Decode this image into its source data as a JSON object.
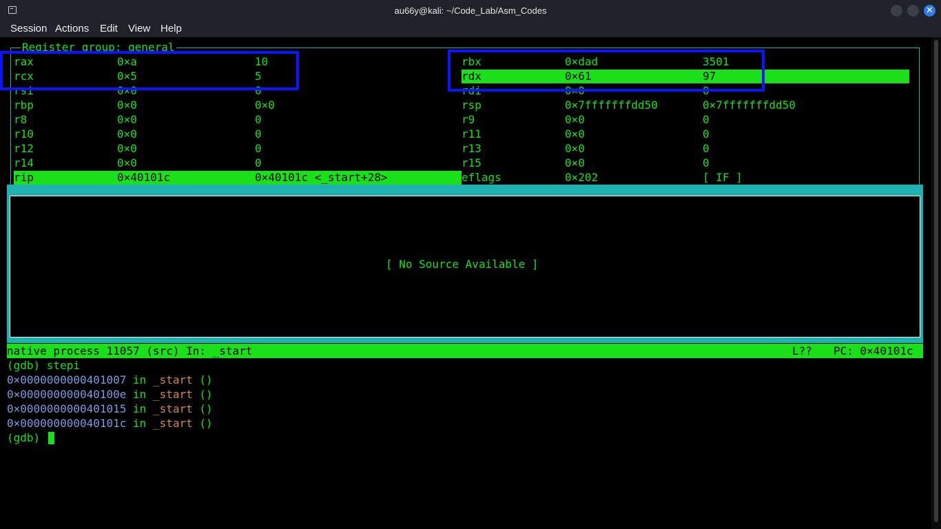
{
  "window": {
    "title": "au66y@kali: ~/Code_Lab/Asm_Codes",
    "close_glyph": "✕"
  },
  "menu": [
    "Session",
    "Actions",
    "Edit",
    "View",
    "Help"
  ],
  "registers": {
    "group_title": "Register group: general",
    "left": [
      {
        "name": "rax",
        "hex": "0×a",
        "val": "10"
      },
      {
        "name": "rcx",
        "hex": "0×5",
        "val": "5"
      },
      {
        "name": "rsi",
        "hex": "0×0",
        "val": "0"
      },
      {
        "name": "rbp",
        "hex": "0×0",
        "val": "0×0"
      },
      {
        "name": "r8",
        "hex": "0×0",
        "val": "0"
      },
      {
        "name": "r10",
        "hex": "0×0",
        "val": "0"
      },
      {
        "name": "r12",
        "hex": "0×0",
        "val": "0"
      },
      {
        "name": "r14",
        "hex": "0×0",
        "val": "0"
      },
      {
        "name": "rip",
        "hex": "0×40101c",
        "val": "0×40101c <_start+28>"
      }
    ],
    "right": [
      {
        "name": "rbx",
        "hex": "0×dad",
        "val": "3501"
      },
      {
        "name": "rdx",
        "hex": "0×61",
        "val": "97"
      },
      {
        "name": "rdi",
        "hex": "0×0",
        "val": "0"
      },
      {
        "name": "rsp",
        "hex": "0×7fffffffdd50",
        "val": "0×7fffffffdd50"
      },
      {
        "name": "r9",
        "hex": "0×0",
        "val": "0"
      },
      {
        "name": "r11",
        "hex": "0×0",
        "val": "0"
      },
      {
        "name": "r13",
        "hex": "0×0",
        "val": "0"
      },
      {
        "name": "r15",
        "hex": "0×0",
        "val": "0"
      },
      {
        "name": "eflags",
        "hex": "0×202",
        "val": "[ IF ]"
      }
    ]
  },
  "source": {
    "message": "[ No Source Available ]"
  },
  "status": {
    "left": "native process 11057 (src) In: _start",
    "line": "L??",
    "pc": "PC: 0×40101c"
  },
  "console": {
    "command_line": "(gdb) stepi",
    "lines": [
      {
        "addr": "0×0000000000401007",
        "in": "in",
        "fn": "_start",
        "args": "()"
      },
      {
        "addr": "0×000000000040100e",
        "in": "in",
        "fn": "_start",
        "args": "()"
      },
      {
        "addr": "0×0000000000401015",
        "in": "in",
        "fn": "_start",
        "args": "()"
      },
      {
        "addr": "0×000000000040101c",
        "in": "in",
        "fn": "_start",
        "args": "()"
      }
    ],
    "prompt": "(gdb)"
  },
  "colors": {
    "terminal_green": "#19e019",
    "frame_teal": "#1fb0b0",
    "address_blue": "#7b9be0",
    "function_orange": "#d08a4a",
    "annotation_blue": "#0a16ff"
  }
}
